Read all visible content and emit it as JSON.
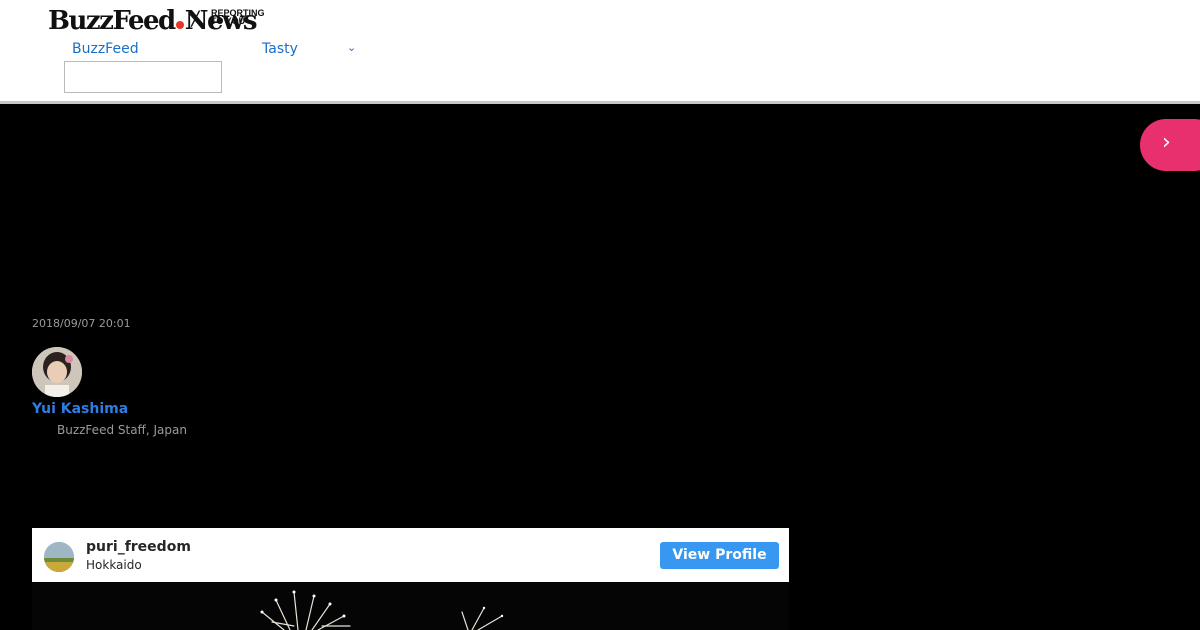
{
  "header": {
    "logo_part1": "BuzzFeed",
    "logo_part2": "News",
    "logo_slash": "/",
    "tagline_line1": "REPORTING",
    "tagline_line2": "TO YOU",
    "nav": {
      "buzzfeed_label": "BuzzFeed",
      "tasty_label": "Tasty"
    },
    "search": {
      "value": "",
      "placeholder": ""
    }
  },
  "article": {
    "timestamp": "2018/09/07 20:01",
    "author": {
      "name": "Yui Kashima",
      "title": "BuzzFeed Staff, Japan"
    }
  },
  "embed": {
    "username": "puri_freedom",
    "location": "Hokkaido",
    "view_profile_label": "View Profile"
  },
  "icons": {
    "next": "chevron-right-icon",
    "nav_dropdown": "chevron-down-icon"
  },
  "colors": {
    "accent_pink": "#e8306e",
    "link_blue": "#1a6fc9",
    "author_blue": "#2e7de0",
    "instagram_blue": "#3897f0"
  }
}
